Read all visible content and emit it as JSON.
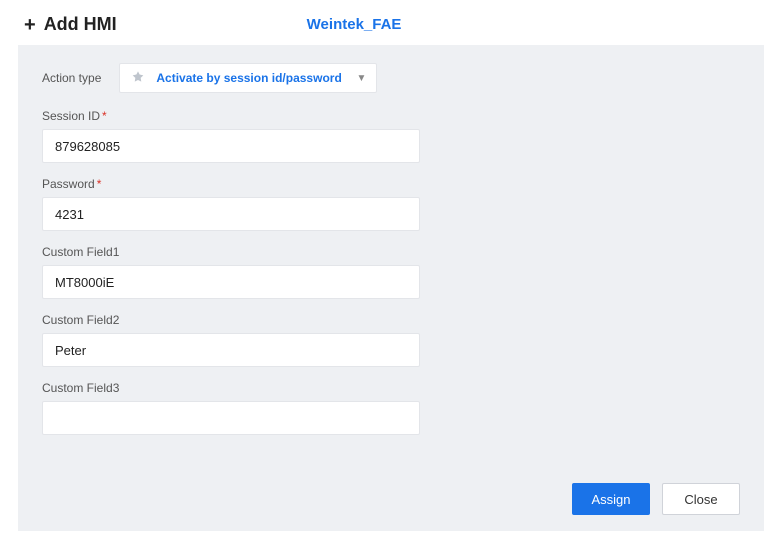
{
  "header": {
    "title": "Add HMI",
    "domain": "Weintek_FAE"
  },
  "action": {
    "label": "Action type",
    "selected": "Activate by session id/password"
  },
  "fields": {
    "session_id": {
      "label": "Session ID",
      "required": true,
      "value": "879628085"
    },
    "password": {
      "label": "Password",
      "required": true,
      "value": "4231"
    },
    "custom1": {
      "label": "Custom Field1",
      "value": "MT8000iE"
    },
    "custom2": {
      "label": "Custom Field2",
      "value": "Peter"
    },
    "custom3": {
      "label": "Custom Field3",
      "value": ""
    }
  },
  "buttons": {
    "assign": "Assign",
    "close": "Close"
  }
}
